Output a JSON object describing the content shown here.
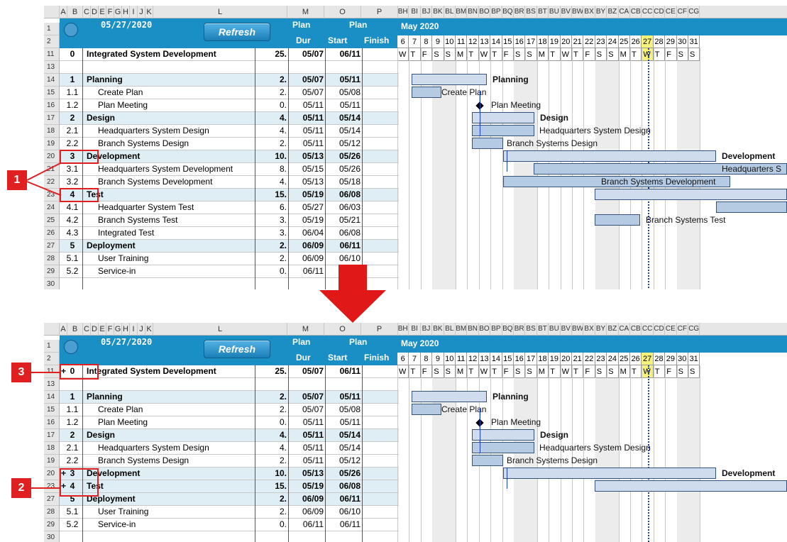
{
  "column_headers": [
    "A",
    "B",
    "C",
    "D",
    "E",
    "F",
    "G",
    "H",
    "I",
    "J",
    "K",
    "L",
    "M",
    "O",
    "P"
  ],
  "gantt_column_headers": [
    "BH",
    "BI",
    "BJ",
    "BK",
    "BL",
    "BM",
    "BN",
    "BO",
    "BP",
    "BQ",
    "BR",
    "BS",
    "BT",
    "BU",
    "BV",
    "BW",
    "BX",
    "BY",
    "BZ",
    "CA",
    "CB",
    "CC",
    "CD",
    "CE",
    "CF",
    "CG"
  ],
  "header": {
    "date": "05/27/2020",
    "refresh_label": "Refresh",
    "plan_dur_top": "Plan",
    "plan_dur_bottom": "Dur",
    "plan_label": "Plan",
    "start_label": "Start",
    "finish_label": "Finish",
    "month_label": "May 2020"
  },
  "days": [
    "6",
    "7",
    "8",
    "9",
    "10",
    "11",
    "12",
    "13",
    "14",
    "15",
    "16",
    "17",
    "18",
    "19",
    "20",
    "21",
    "22",
    "23",
    "24",
    "25",
    "26",
    "27",
    "28",
    "29",
    "30",
    "31"
  ],
  "weekdays": [
    "W",
    "T",
    "F",
    "S",
    "S",
    "M",
    "T",
    "W",
    "T",
    "F",
    "S",
    "S",
    "M",
    "T",
    "W",
    "T",
    "F",
    "S",
    "S",
    "M",
    "T",
    "W",
    "T",
    "F",
    "S",
    "S"
  ],
  "top_table": {
    "rows": [
      {
        "rownum": "1",
        "wbs": "",
        "task": "",
        "dur": "",
        "start": "",
        "finish": "",
        "type": "blank"
      },
      {
        "rownum": "2",
        "wbs": "",
        "task": "",
        "dur": "",
        "start": "",
        "finish": "",
        "type": "blank"
      },
      {
        "rownum": "11",
        "wbs": "0",
        "task": "Integrated System Development",
        "dur": "25.",
        "start": "05/07",
        "finish": "06/11",
        "type": "top"
      },
      {
        "rownum": "13",
        "wbs": "",
        "task": "",
        "dur": "",
        "start": "",
        "finish": "",
        "type": "blank"
      },
      {
        "rownum": "14",
        "wbs": "1",
        "task": "Planning",
        "dur": "2.",
        "start": "05/07",
        "finish": "05/11",
        "type": "sum"
      },
      {
        "rownum": "15",
        "wbs": "1.1",
        "task": "Create Plan",
        "dur": "2.",
        "start": "05/07",
        "finish": "05/08",
        "type": "task"
      },
      {
        "rownum": "16",
        "wbs": "1.2",
        "task": "Plan Meeting",
        "dur": "0.",
        "start": "05/11",
        "finish": "05/11",
        "type": "task"
      },
      {
        "rownum": "17",
        "wbs": "2",
        "task": "Design",
        "dur": "4.",
        "start": "05/11",
        "finish": "05/14",
        "type": "sum"
      },
      {
        "rownum": "18",
        "wbs": "2.1",
        "task": "Headquarters System Design",
        "dur": "4.",
        "start": "05/11",
        "finish": "05/14",
        "type": "task"
      },
      {
        "rownum": "19",
        "wbs": "2.2",
        "task": "Branch Systems Design",
        "dur": "2.",
        "start": "05/11",
        "finish": "05/12",
        "type": "task"
      },
      {
        "rownum": "20",
        "wbs": "3",
        "task": "Development",
        "dur": "10.",
        "start": "05/13",
        "finish": "05/26",
        "type": "sum"
      },
      {
        "rownum": "21",
        "wbs": "3.1",
        "task": "Headquarters System Development",
        "dur": "8.",
        "start": "05/15",
        "finish": "05/26",
        "type": "task"
      },
      {
        "rownum": "22",
        "wbs": "3.2",
        "task": "Branch Systems Development",
        "dur": "4.",
        "start": "05/13",
        "finish": "05/18",
        "type": "task"
      },
      {
        "rownum": "23",
        "wbs": "4",
        "task": "Test",
        "dur": "15.",
        "start": "05/19",
        "finish": "06/08",
        "type": "sum"
      },
      {
        "rownum": "24",
        "wbs": "4.1",
        "task": "Headquarter System Test",
        "dur": "6.",
        "start": "05/27",
        "finish": "06/03",
        "type": "task"
      },
      {
        "rownum": "25",
        "wbs": "4.2",
        "task": "Branch Systems Test",
        "dur": "3.",
        "start": "05/19",
        "finish": "05/21",
        "type": "task"
      },
      {
        "rownum": "26",
        "wbs": "4.3",
        "task": "Integrated Test",
        "dur": "3.",
        "start": "06/04",
        "finish": "06/08",
        "type": "task"
      },
      {
        "rownum": "27",
        "wbs": "5",
        "task": "Deployment",
        "dur": "2.",
        "start": "06/09",
        "finish": "06/11",
        "type": "sum"
      },
      {
        "rownum": "28",
        "wbs": "5.1",
        "task": "User Training",
        "dur": "2.",
        "start": "06/09",
        "finish": "06/10",
        "type": "task"
      },
      {
        "rownum": "29",
        "wbs": "5.2",
        "task": "Service-in",
        "dur": "0.",
        "start": "06/11",
        "finish": "06/11",
        "type": "task"
      },
      {
        "rownum": "30",
        "wbs": "",
        "task": "",
        "dur": "",
        "start": "",
        "finish": "",
        "type": "blank"
      }
    ],
    "bar_labels": {
      "planning": "Planning",
      "create_plan": "Create Plan",
      "plan_meeting": "Plan Meeting",
      "design": "Design",
      "hq_design": "Headquarters System Design",
      "branch_design": "Branch Systems Design",
      "development": "Development",
      "hq_development": "Headquarters S",
      "branch_development": "Branch Systems Development",
      "branch_test": "Branch Systems Test"
    }
  },
  "bottom_table": {
    "rows": [
      {
        "rownum": "1",
        "wbs": "",
        "task": "",
        "dur": "",
        "start": "",
        "finish": "",
        "type": "blank"
      },
      {
        "rownum": "2",
        "wbs": "",
        "task": "",
        "dur": "",
        "start": "",
        "finish": "",
        "type": "blank"
      },
      {
        "rownum": "11",
        "wbs": "0",
        "task": "Integrated System Development",
        "dur": "25.",
        "start": "05/07",
        "finish": "06/11",
        "type": "top"
      },
      {
        "rownum": "13",
        "wbs": "",
        "task": "",
        "dur": "",
        "start": "",
        "finish": "",
        "type": "blank"
      },
      {
        "rownum": "14",
        "wbs": "1",
        "task": "Planning",
        "dur": "2.",
        "start": "05/07",
        "finish": "05/11",
        "type": "sum"
      },
      {
        "rownum": "15",
        "wbs": "1.1",
        "task": "Create Plan",
        "dur": "2.",
        "start": "05/07",
        "finish": "05/08",
        "type": "task"
      },
      {
        "rownum": "16",
        "wbs": "1.2",
        "task": "Plan Meeting",
        "dur": "0.",
        "start": "05/11",
        "finish": "05/11",
        "type": "task"
      },
      {
        "rownum": "17",
        "wbs": "2",
        "task": "Design",
        "dur": "4.",
        "start": "05/11",
        "finish": "05/14",
        "type": "sum"
      },
      {
        "rownum": "18",
        "wbs": "2.1",
        "task": "Headquarters System Design",
        "dur": "4.",
        "start": "05/11",
        "finish": "05/14",
        "type": "task"
      },
      {
        "rownum": "19",
        "wbs": "2.2",
        "task": "Branch Systems Design",
        "dur": "2.",
        "start": "05/11",
        "finish": "05/12",
        "type": "task"
      },
      {
        "rownum": "20",
        "wbs": "3",
        "task": "Development",
        "dur": "10.",
        "start": "05/13",
        "finish": "05/26",
        "type": "sum"
      },
      {
        "rownum": "23",
        "wbs": "4",
        "task": "Test",
        "dur": "15.",
        "start": "05/19",
        "finish": "06/08",
        "type": "sum"
      },
      {
        "rownum": "27",
        "wbs": "5",
        "task": "Deployment",
        "dur": "2.",
        "start": "06/09",
        "finish": "06/11",
        "type": "sum"
      },
      {
        "rownum": "28",
        "wbs": "5.1",
        "task": "User Training",
        "dur": "2.",
        "start": "06/09",
        "finish": "06/10",
        "type": "task"
      },
      {
        "rownum": "29",
        "wbs": "5.2",
        "task": "Service-in",
        "dur": "0.",
        "start": "06/11",
        "finish": "06/11",
        "type": "task"
      },
      {
        "rownum": "30",
        "wbs": "",
        "task": "",
        "dur": "",
        "start": "",
        "finish": "",
        "type": "blank"
      }
    ],
    "expand_marker": "+",
    "bar_labels": {
      "planning": "Planning",
      "create_plan": "Create Plan",
      "plan_meeting": "Plan Meeting",
      "design": "Design",
      "hq_design": "Headquarters System Design",
      "branch_design": "Branch Systems Design",
      "development": "Development"
    }
  },
  "callouts": {
    "one": "1",
    "two": "2",
    "three": "3"
  },
  "colors": {
    "header_blue": "#1a8fc6",
    "summary_row": "#dfeef4",
    "callout_red": "#e02020",
    "today_line": "#1c3fc9",
    "today_highlight": "#f7f37a"
  }
}
